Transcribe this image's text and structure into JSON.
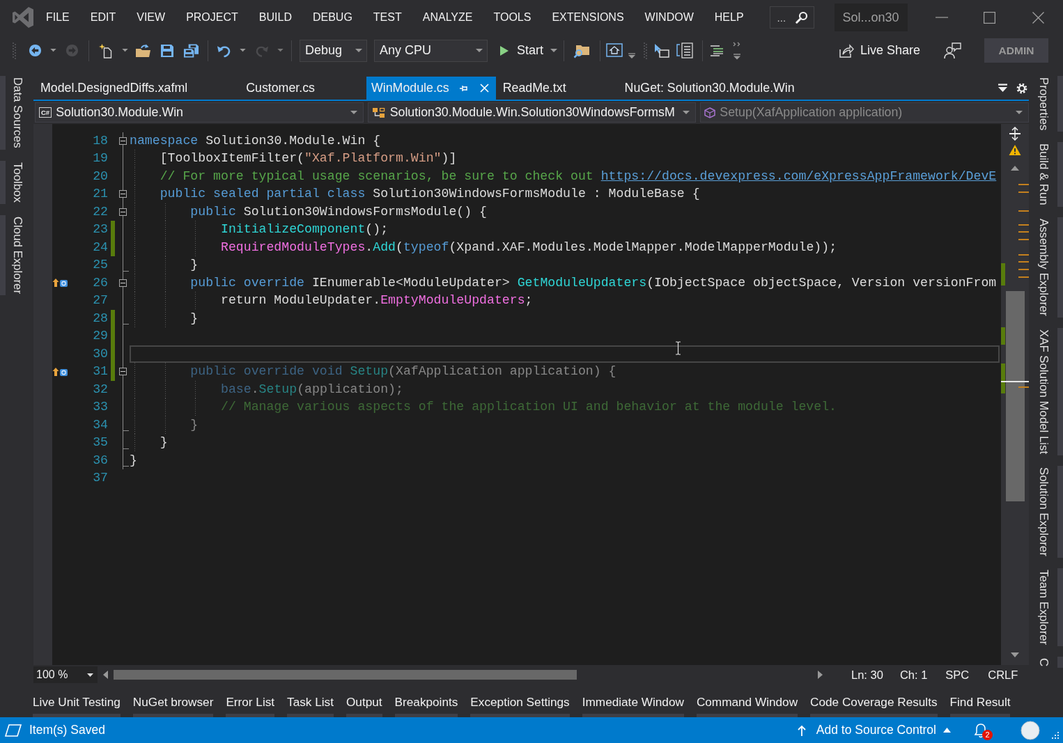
{
  "title_bar": {
    "menu": [
      "FILE",
      "EDIT",
      "VIEW",
      "PROJECT",
      "BUILD",
      "DEBUG",
      "TEST",
      "ANALYZE",
      "TOOLS",
      "EXTENSIONS",
      "WINDOW",
      "HELP"
    ],
    "search": "...",
    "solution_name": "Sol...on30"
  },
  "toolbar": {
    "navigate_back": {
      "disabled": false
    },
    "navigate_forward": {
      "disabled": true
    },
    "undo": {
      "disabled": false
    },
    "redo": {
      "disabled": true
    },
    "configuration": "Debug",
    "platform": "Any CPU",
    "start": "Start",
    "live_share": "Live Share",
    "account": "ADMIN"
  },
  "left_tool_tabs": [
    "Data Sources",
    "Toolbox",
    "Cloud Explorer"
  ],
  "document_tabs": [
    {
      "label": "Model.DesignedDiffs.xafml",
      "selected": false
    },
    {
      "label": "Customer.cs",
      "selected": false
    },
    {
      "label": "WinModule.cs",
      "selected": true
    },
    {
      "label": "ReadMe.txt",
      "selected": false
    },
    {
      "label": "NuGet: Solution30.Module.Win",
      "selected": false
    }
  ],
  "navigation_bar": [
    {
      "kind": "project",
      "badge": "C#",
      "text": "Solution30.Module.Win",
      "dimmed": false
    },
    {
      "kind": "type",
      "text": "Solution30.Module.Win.Solution30WindowsFormsM",
      "dimmed": false
    },
    {
      "kind": "member",
      "text": "Setup(XafApplication application)",
      "dimmed": true
    }
  ],
  "code_lines": [
    {
      "number": "18",
      "outline": {
        "kind": "start",
        "expanded": true
      },
      "changed": false,
      "override": false,
      "dimmed": false,
      "current": false,
      "tokens": [
        {
          "text": "namespace",
          "kind": "keyword"
        },
        {
          "text": " Solution30.Module.Win {",
          "kind": "plain"
        }
      ]
    },
    {
      "number": "19",
      "outline": {
        "kind": "line"
      },
      "changed": false,
      "override": false,
      "dimmed": false,
      "current": false,
      "tokens": [
        {
          "text": "    [ToolboxItemFilter(",
          "kind": "plain"
        },
        {
          "text": "\"Xaf.Platform.Win\"",
          "kind": "string"
        },
        {
          "text": ")]",
          "kind": "plain"
        }
      ]
    },
    {
      "number": "20",
      "outline": {
        "kind": "line"
      },
      "changed": false,
      "override": false,
      "dimmed": false,
      "current": false,
      "tokens": [
        {
          "text": "    // For more typical usage scenarios, be sure to check out ",
          "kind": "comment"
        },
        {
          "text": "https://docs.devexpress.com/eXpressAppFramework/DevE",
          "kind": "link"
        }
      ]
    },
    {
      "number": "21",
      "outline": {
        "kind": "start",
        "expanded": true
      },
      "changed": false,
      "override": false,
      "dimmed": false,
      "current": false,
      "tokens": [
        {
          "text": "    public sealed partial class",
          "kind": "keyword"
        },
        {
          "text": " Solution30WindowsFormsModule : ModuleBase {",
          "kind": "plain"
        }
      ]
    },
    {
      "number": "22",
      "outline": {
        "kind": "start",
        "expanded": true
      },
      "changed": false,
      "override": false,
      "dimmed": false,
      "current": false,
      "tokens": [
        {
          "text": "        public",
          "kind": "keyword"
        },
        {
          "text": " Solution30WindowsFormsModule() {",
          "kind": "plain"
        }
      ]
    },
    {
      "number": "23",
      "outline": {
        "kind": "line"
      },
      "changed": true,
      "override": false,
      "dimmed": false,
      "current": false,
      "tokens": [
        {
          "text": "            InitializeComponent",
          "kind": "method"
        },
        {
          "text": "();",
          "kind": "plain"
        }
      ]
    },
    {
      "number": "24",
      "outline": {
        "kind": "line"
      },
      "changed": true,
      "override": false,
      "dimmed": false,
      "current": false,
      "tokens": [
        {
          "text": "            RequiredModuleTypes",
          "kind": "member"
        },
        {
          "text": ".",
          "kind": "plain"
        },
        {
          "text": "Add",
          "kind": "method"
        },
        {
          "text": "(",
          "kind": "plain"
        },
        {
          "text": "typeof",
          "kind": "keyword"
        },
        {
          "text": "(Xpand.XAF.Modules.ModelMapper.ModelMapperModule));",
          "kind": "plain"
        }
      ]
    },
    {
      "number": "25",
      "outline": {
        "kind": "end"
      },
      "changed": false,
      "override": false,
      "dimmed": false,
      "current": false,
      "tokens": [
        {
          "text": "        }",
          "kind": "plain"
        }
      ]
    },
    {
      "number": "26",
      "outline": {
        "kind": "start",
        "expanded": true
      },
      "changed": false,
      "override": true,
      "dimmed": false,
      "current": false,
      "tokens": [
        {
          "text": "        public override",
          "kind": "keyword"
        },
        {
          "text": " IEnumerable<ModuleUpdater> ",
          "kind": "plain"
        },
        {
          "text": "GetModuleUpdaters",
          "kind": "method"
        },
        {
          "text": "(IObjectSpace objectSpace, Version versionFrom",
          "kind": "plain"
        }
      ]
    },
    {
      "number": "27",
      "outline": {
        "kind": "line"
      },
      "changed": false,
      "override": false,
      "dimmed": false,
      "current": false,
      "tokens": [
        {
          "text": "            return ModuleUpdater.",
          "kind": "plain"
        },
        {
          "text": "EmptyModuleUpdaters",
          "kind": "member"
        },
        {
          "text": ";",
          "kind": "plain"
        }
      ]
    },
    {
      "number": "28",
      "outline": {
        "kind": "end"
      },
      "changed": true,
      "override": false,
      "dimmed": false,
      "current": false,
      "tokens": [
        {
          "text": "        }",
          "kind": "plain"
        }
      ]
    },
    {
      "number": "29",
      "outline": {
        "kind": "line"
      },
      "changed": true,
      "override": false,
      "current": false
    },
    {
      "number": "30",
      "outline": {
        "kind": "line"
      },
      "changed": true,
      "override": false,
      "current": true
    },
    {
      "number": "31",
      "outline": {
        "kind": "start",
        "expanded": true
      },
      "changed": true,
      "override": true,
      "dimmed": true,
      "current": false,
      "tokens": [
        {
          "text": "        public override void ",
          "kind": "keyword"
        },
        {
          "text": "Setup",
          "kind": "method"
        },
        {
          "text": "(XafApplication application) {",
          "kind": "plain"
        }
      ]
    },
    {
      "number": "32",
      "outline": {
        "kind": "line"
      },
      "changed": false,
      "override": false,
      "dimmed": true,
      "current": false,
      "tokens": [
        {
          "text": "            base",
          "kind": "keyword"
        },
        {
          "text": ".",
          "kind": "plain"
        },
        {
          "text": "Setup",
          "kind": "method"
        },
        {
          "text": "(application);",
          "kind": "plain"
        }
      ]
    },
    {
      "number": "33",
      "outline": {
        "kind": "line"
      },
      "changed": false,
      "override": false,
      "dimmed": true,
      "current": false,
      "tokens": [
        {
          "text": "            // Manage various aspects of the application UI and behavior at the module level.",
          "kind": "comment"
        }
      ]
    },
    {
      "number": "34",
      "outline": {
        "kind": "end"
      },
      "changed": false,
      "override": false,
      "dimmed": true,
      "current": false,
      "tokens": [
        {
          "text": "        }",
          "kind": "plain"
        }
      ]
    },
    {
      "number": "35",
      "outline": {
        "kind": "end"
      },
      "changed": false,
      "override": false,
      "dimmed": false,
      "current": false,
      "tokens": [
        {
          "text": "    }",
          "kind": "plain"
        }
      ]
    },
    {
      "number": "36",
      "outline": {
        "kind": "end"
      },
      "changed": false,
      "override": false,
      "dimmed": false,
      "current": false,
      "tokens": [
        {
          "text": "}",
          "kind": "plain"
        }
      ]
    },
    {
      "number": "37",
      "changed": false,
      "override": false,
      "current": false
    }
  ],
  "editor_footer": {
    "zoom": "100 %",
    "line": "Ln: 30",
    "column": "Ch: 1",
    "indentation": "SPC",
    "line_endings": "CRLF"
  },
  "right_tool_tabs": [
    "Properties",
    "Build & Run",
    "Assembly Explorer",
    "XAF Solution Model List",
    "Solution Explorer",
    "Team Explorer",
    "C"
  ],
  "bottom_tool_tabs": [
    "Live Unit Testing",
    "NuGet browser",
    "Error List",
    "Task List",
    "Output",
    "Breakpoints",
    "Exception Settings",
    "Immediate Window",
    "Command Window",
    "Code Coverage Results",
    "Find Result"
  ],
  "status_bar": {
    "message": "Item(s) Saved",
    "source_control": "Add to Source Control",
    "notifications": "2"
  }
}
